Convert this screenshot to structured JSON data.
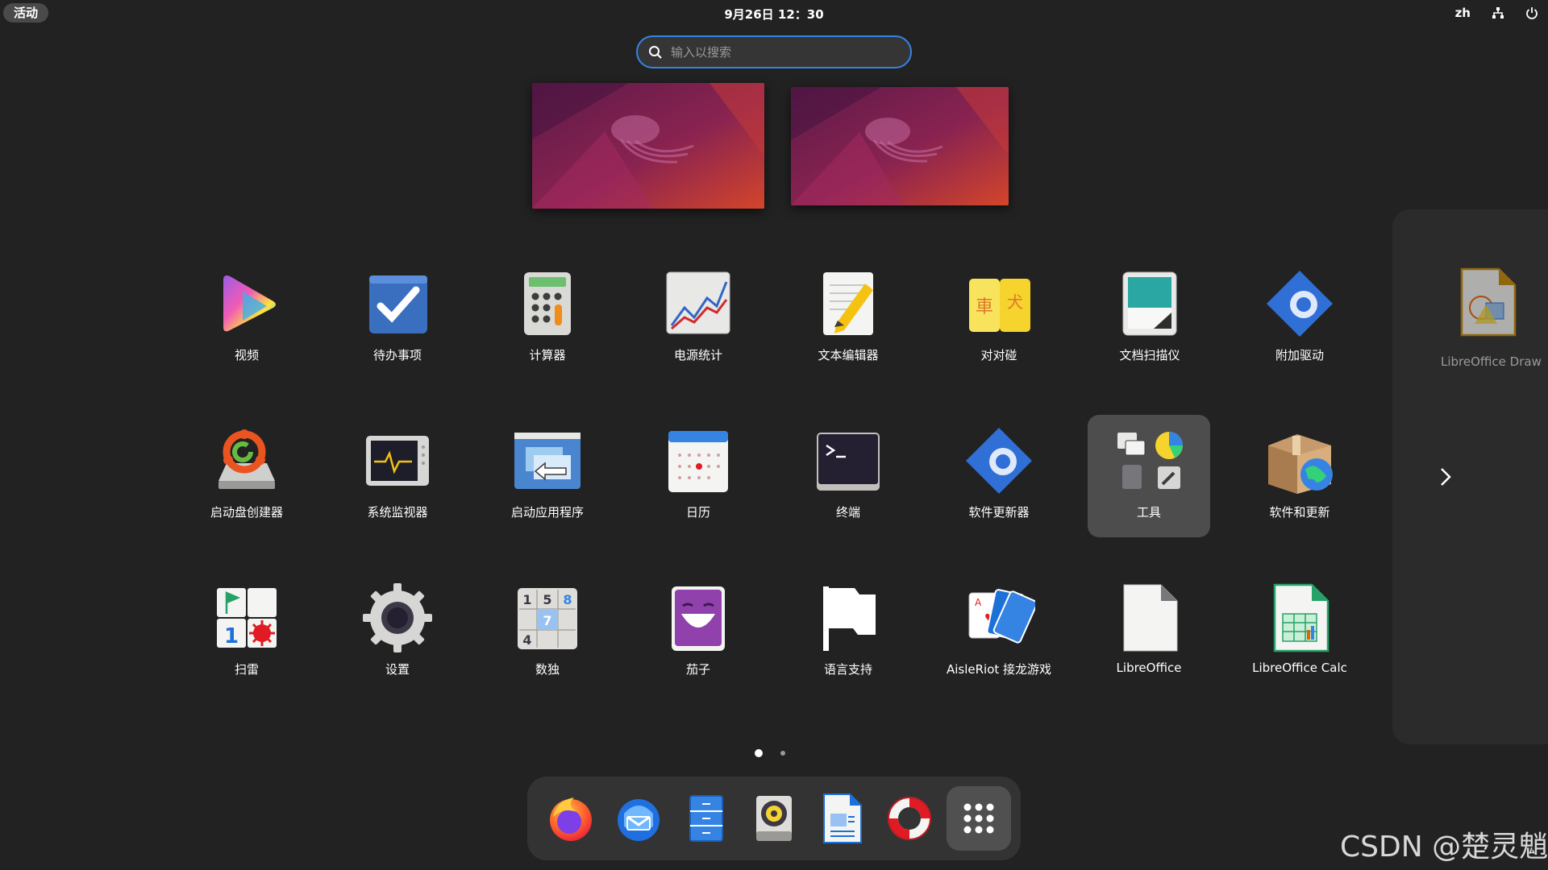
{
  "topbar": {
    "activities": "活动",
    "clock": "9月26日  12：30",
    "lang": "zh",
    "network_icon": "network-wired-icon",
    "power_icon": "power-icon"
  },
  "search": {
    "placeholder": "输入以搜索"
  },
  "apps": [
    {
      "label": "视频",
      "icon": "videos-icon"
    },
    {
      "label": "待办事项",
      "icon": "todo-icon"
    },
    {
      "label": "计算器",
      "icon": "calculator-icon"
    },
    {
      "label": "电源统计",
      "icon": "power-statistics-icon"
    },
    {
      "label": "文本编辑器",
      "icon": "text-editor-icon"
    },
    {
      "label": "对对碰",
      "icon": "mahjongg-icon"
    },
    {
      "label": "文档扫描仪",
      "icon": "document-scanner-icon"
    },
    {
      "label": "附加驱动",
      "icon": "additional-drivers-icon"
    },
    {
      "label": "启动盘创建器",
      "icon": "startup-disk-creator-icon"
    },
    {
      "label": "系统监视器",
      "icon": "system-monitor-icon"
    },
    {
      "label": "启动应用程序",
      "icon": "startup-applications-icon"
    },
    {
      "label": "日历",
      "icon": "calendar-icon"
    },
    {
      "label": "终端",
      "icon": "terminal-icon"
    },
    {
      "label": "软件更新器",
      "icon": "software-updater-icon"
    },
    {
      "label": "工具",
      "icon": "utilities-folder-icon"
    },
    {
      "label": "软件和更新",
      "icon": "software-properties-icon"
    },
    {
      "label": "扫雷",
      "icon": "mines-icon"
    },
    {
      "label": "设置",
      "icon": "settings-gear-icon"
    },
    {
      "label": "数独",
      "icon": "sudoku-icon"
    },
    {
      "label": "茄子",
      "icon": "cheese-icon"
    },
    {
      "label": "语言支持",
      "icon": "language-support-flag-icon"
    },
    {
      "label": "AisleRiot 接龙游戏",
      "icon": "aisleriot-cards-icon"
    },
    {
      "label": "LibreOffice",
      "icon": "libreoffice-icon"
    },
    {
      "label": "LibreOffice Calc",
      "icon": "libreoffice-calc-icon"
    }
  ],
  "peek": {
    "label": "LibreOffice Draw",
    "icon": "libreoffice-draw-icon",
    "next_icon": "chevron-right-icon"
  },
  "dock": [
    {
      "name": "firefox",
      "icon": "firefox-icon"
    },
    {
      "name": "thunderbird",
      "icon": "thunderbird-icon"
    },
    {
      "name": "files",
      "icon": "files-icon"
    },
    {
      "name": "rhythmbox",
      "icon": "rhythmbox-icon"
    },
    {
      "name": "libreoffice-writer",
      "icon": "libreoffice-writer-icon"
    },
    {
      "name": "help",
      "icon": "help-lifebuoy-icon"
    },
    {
      "name": "show-apps",
      "icon": "show-apps-grid-icon"
    }
  ],
  "watermark": "CSDN @楚灵魈",
  "colors": {
    "background": "#222222",
    "accent": "#3584e4",
    "selected": "#4d4d4d"
  }
}
